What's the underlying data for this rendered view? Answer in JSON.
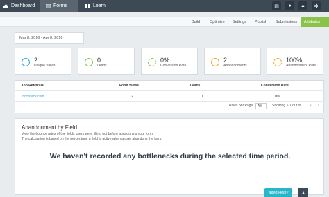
{
  "nav": {
    "tabs": [
      {
        "label": "Dashboard",
        "icon": "home-icon"
      },
      {
        "label": "Forms",
        "icon": "forms-icon"
      },
      {
        "label": "Learn",
        "icon": "book-icon"
      }
    ],
    "active_tab": "Forms",
    "right_icons": [
      "book-icon",
      "user-icon",
      "bell-icon",
      "settings-icon"
    ]
  },
  "subnav": {
    "tabs": [
      "Build",
      "Optimize",
      "Settings",
      "Publish",
      "Submissions",
      "Attribution"
    ],
    "active": "Attribution"
  },
  "date_range": "Mar 8, 2016 - Apr 8, 2016",
  "stats": [
    {
      "value": "2",
      "label": "Unique Views",
      "icon": "eye-icon",
      "color": "#2fa3d9"
    },
    {
      "value": "0",
      "label": "Leads",
      "icon": "lead-icon",
      "color": "#8bc34a"
    },
    {
      "value": "0%",
      "label": "Conversion Rate",
      "icon": "refresh-icon",
      "color": "#8bc34a"
    },
    {
      "value": "2",
      "label": "Abandonments",
      "icon": "ban-icon",
      "color": "#f5a623"
    },
    {
      "value": "100%",
      "label": "Abandonment Rate",
      "icon": "refresh-icon",
      "color": "#f5a623"
    }
  ],
  "referrals": {
    "headers": [
      "Top Referrals",
      "Form Views",
      "Leads",
      "Conversion Rate"
    ],
    "rows": [
      {
        "source": "formstack.com",
        "views": "2",
        "leads": "0",
        "rate": "0%"
      }
    ],
    "rows_per_page_label": "Rows per Page:",
    "rows_per_page_value": "All",
    "range_text": "Showing 1-1 out of 1"
  },
  "abandonment": {
    "title": "Abandonment by Field",
    "desc1": "View the bounce rates of the fields users were filling out before abandoning your form.",
    "desc2": "The calculation is based on the percentage a field is active when a user abandons the form.",
    "empty_message": "We haven't recorded any bottlenecks during the selected time period."
  },
  "help_label": "Need Help?"
}
